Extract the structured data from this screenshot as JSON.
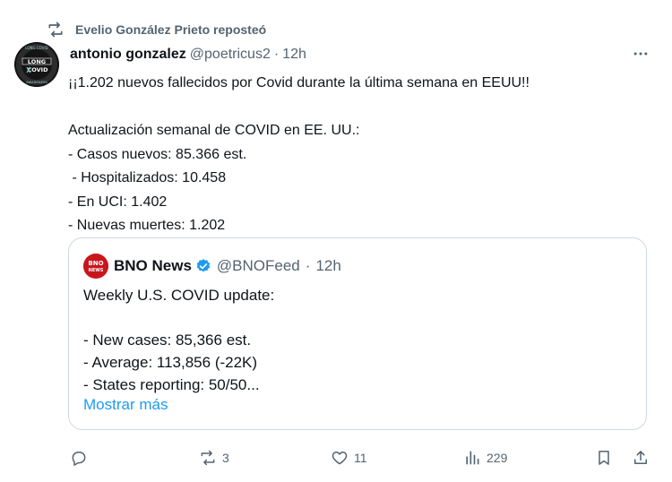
{
  "repost": {
    "label": "Evelio González Prieto reposteó",
    "icon": "repost-icon"
  },
  "tweet": {
    "author_name": "antonio gonzalez",
    "author_handle": "@poetricus2",
    "separator": "·",
    "time": "12h",
    "avatar_text": [
      "LONG",
      "COVID"
    ],
    "avatar_arc": [
      "LONG COVID",
      "AWARENESS"
    ],
    "body": "¡¡1.202 nuevos fallecidos por Covid durante la última semana en EEUU!!\n\nActualización semanal de COVID en EE. UU.:\n- Casos nuevos: 85.366 est.\n - Hospitalizados: 10.458\n- En UCI: 1.402\n- Nuevas muertes: 1.202"
  },
  "quote": {
    "author_name": "BNO News",
    "author_handle": "@BNOFeed",
    "separator": "·",
    "time": "12h",
    "avatar_text": [
      "BNO",
      "NEWS"
    ],
    "verified_color": "#1d9bf0",
    "body": "Weekly U.S. COVID update:\n\n- New cases: 85,366 est.\n- Average: 113,856 (-22K)\n- States reporting: 50/50...",
    "show_more": "Mostrar más"
  },
  "actions": {
    "reply_count": "",
    "repost_count": "3",
    "like_count": "11",
    "views_count": "229"
  },
  "colors": {
    "text": "#0f1419",
    "secondary": "#536471",
    "link": "#1d9bf0",
    "border": "#cfd9de",
    "bno_red": "#c9161d"
  }
}
